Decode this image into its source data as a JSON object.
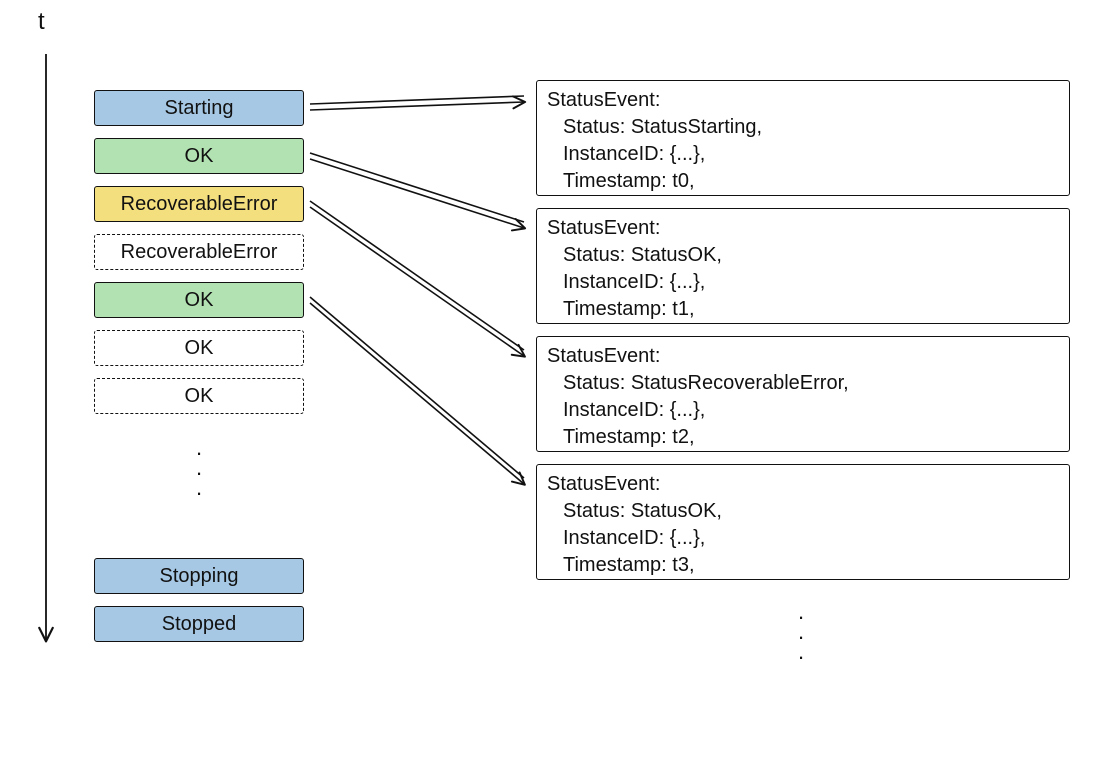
{
  "time_axis_label": "t",
  "statuses": [
    {
      "label": "Starting",
      "fill": "blue",
      "style": "solid",
      "emits": 0
    },
    {
      "label": "OK",
      "fill": "green",
      "style": "solid",
      "emits": 1
    },
    {
      "label": "RecoverableError",
      "fill": "yellow",
      "style": "solid",
      "emits": 2
    },
    {
      "label": "RecoverableError",
      "fill": "white",
      "style": "dashed",
      "emits": null
    },
    {
      "label": "OK",
      "fill": "green",
      "style": "solid",
      "emits": 3
    },
    {
      "label": "OK",
      "fill": "white",
      "style": "dashed",
      "emits": null
    },
    {
      "label": "OK",
      "fill": "white",
      "style": "dashed",
      "emits": null
    },
    {
      "label": "Stopping",
      "fill": "blue",
      "style": "solid",
      "emits": null
    },
    {
      "label": "Stopped",
      "fill": "blue",
      "style": "solid",
      "emits": null
    }
  ],
  "events": [
    {
      "title": "StatusEvent:",
      "status": "Status: StatusStarting,",
      "instance": "InstanceID: {...},",
      "ts": "Timestamp: t0,"
    },
    {
      "title": "StatusEvent:",
      "status": "Status: StatusOK,",
      "instance": "InstanceID: {...},",
      "ts": "Timestamp: t1,"
    },
    {
      "title": "StatusEvent:",
      "status": "Status: StatusRecoverableError,",
      "instance": "InstanceID: {...},",
      "ts": "Timestamp: t2,"
    },
    {
      "title": "StatusEvent:",
      "status": "Status: StatusOK,",
      "instance": "InstanceID: {...},",
      "ts": "Timestamp: t3,"
    }
  ],
  "colors": {
    "blue": "#a6c8e4",
    "green": "#b2e2b2",
    "yellow": "#f3df7e",
    "stroke": "#111111"
  }
}
